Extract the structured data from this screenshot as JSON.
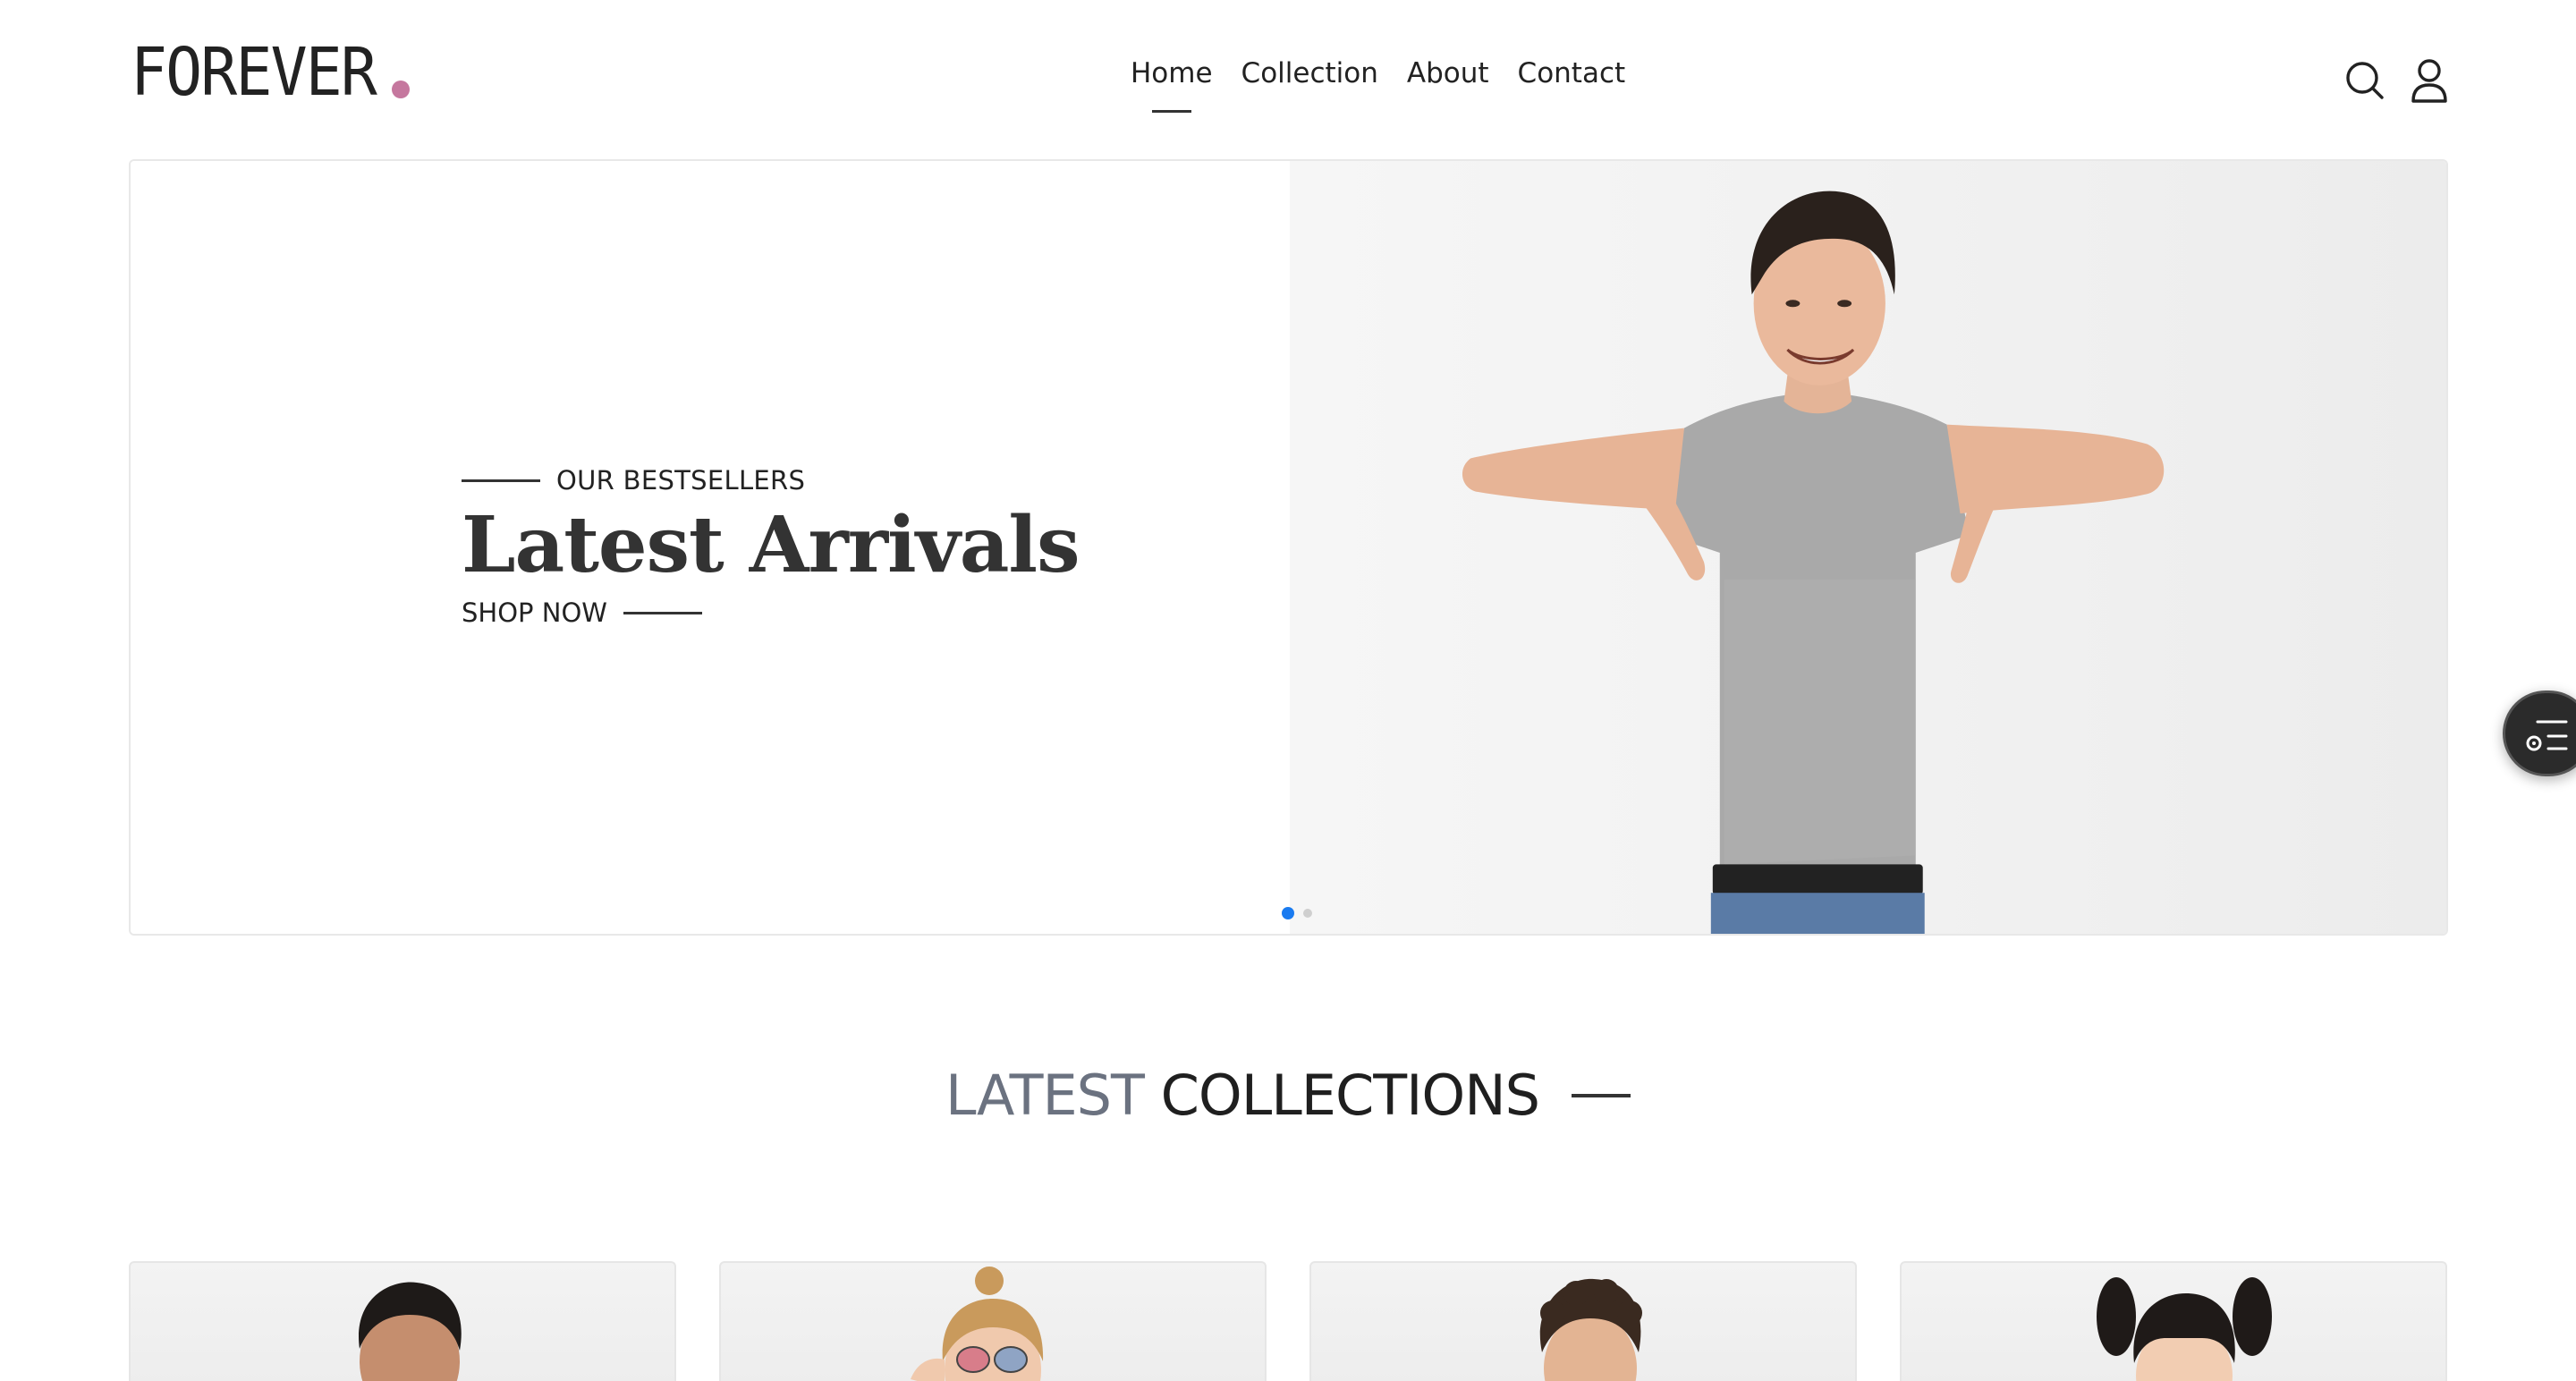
{
  "brand": {
    "name": "FOREVER",
    "dot_color": "#c5779e"
  },
  "nav": {
    "items": [
      {
        "label": "Home",
        "active": true
      },
      {
        "label": "Collection",
        "active": false
      },
      {
        "label": "About",
        "active": false
      },
      {
        "label": "Contact",
        "active": false
      }
    ]
  },
  "header_icons": {
    "search": "search-icon",
    "profile": "user-profile-icon"
  },
  "hero": {
    "eyebrow": "OUR BESTSELLERS",
    "title": "Latest Arrivals",
    "cta": "SHOP NOW",
    "image": "man-in-gray-tshirt-pointing-down",
    "slides": 2,
    "active_slide": 1,
    "dot_active_color": "#1a7bf0"
  },
  "floating_tab": {
    "icon": "settings-list-icon"
  },
  "collections": {
    "title_light": "LATEST",
    "title_bold": "COLLECTIONS",
    "products": [
      {
        "image": "man-product-photo"
      },
      {
        "image": "woman-sunglasses-product-photo"
      },
      {
        "image": "curly-hair-man-product-photo"
      },
      {
        "image": "girl-pigtails-product-photo"
      }
    ]
  }
}
